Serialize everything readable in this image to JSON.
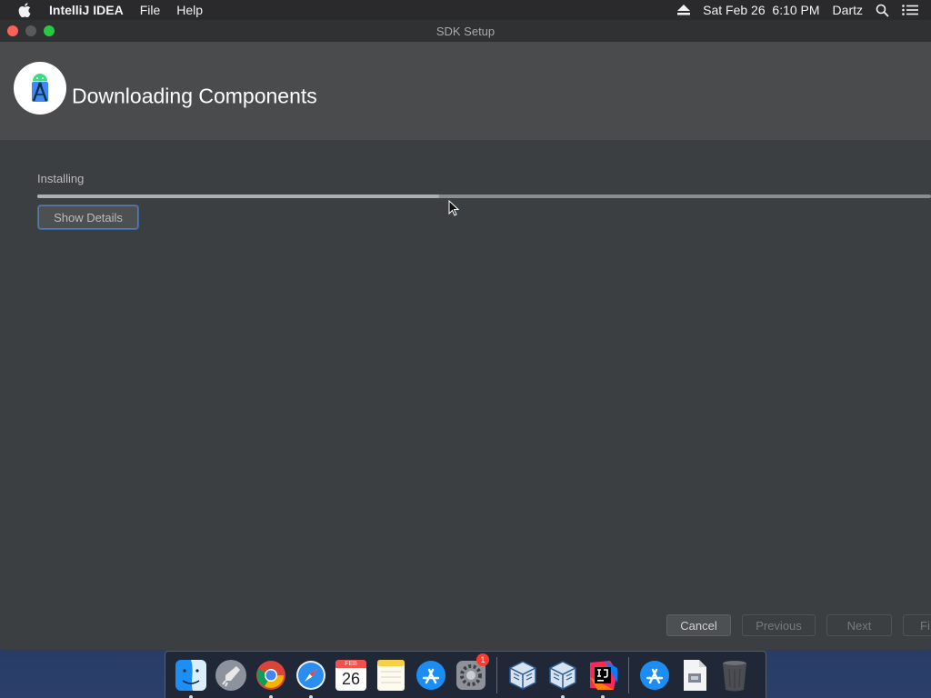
{
  "menubar": {
    "app_name": "IntelliJ IDEA",
    "menus": [
      "File",
      "Help"
    ],
    "datetime": "Sat Feb 26  6:10 PM",
    "user": "Dartz"
  },
  "window": {
    "title": "SDK Setup",
    "header_title": "Downloading Components",
    "status_label": "Installing",
    "progress_fraction": 0.45,
    "show_details_label": "Show Details",
    "buttons": {
      "cancel": "Cancel",
      "previous": "Previous",
      "next": "Next",
      "finish": "Fi"
    }
  },
  "dock": {
    "calendar_month": "FEB",
    "calendar_day": "26",
    "settings_badge": "1",
    "items": [
      "finder-icon",
      "launchpad-icon",
      "chrome-icon",
      "safari-icon",
      "calendar-icon",
      "notes-icon",
      "app-store-icon",
      "system-preferences-icon",
      "virtualbox-icon",
      "virtualbox-icon",
      "intellij-icon",
      "app-store-downloads-icon",
      "document-icon",
      "trash-icon"
    ]
  },
  "colors": {
    "window_bg": "#3c3f41",
    "header_bg": "#4a4b4d",
    "focus_ring": "#3c6aa3",
    "close": "#fe5f57",
    "maximize": "#28c840"
  }
}
